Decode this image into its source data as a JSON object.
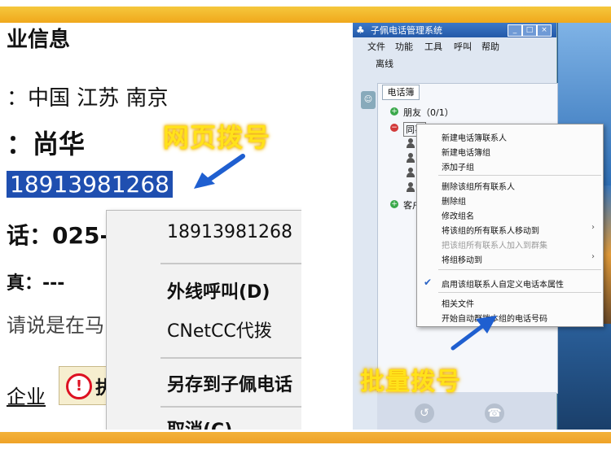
{
  "left_page": {
    "title": "业信息",
    "location": "：中国 江苏 南京",
    "name": "：尚华",
    "phone_selected": "18913981268",
    "tel_row": "话：025-",
    "fax_row": "真：---",
    "note": "请说是在马",
    "company_link": "企业",
    "warn_button_icon": "!",
    "warn_button_label": "执"
  },
  "left_context_menu": {
    "items": [
      {
        "label": "18913981268"
      },
      {
        "label": "外线呼叫(D)"
      },
      {
        "label": "CNetCC代拨"
      },
      {
        "label": "另存到子佩电话"
      },
      {
        "label": "取消(C)"
      }
    ]
  },
  "annotations": {
    "web_dial": "网页拨号",
    "batch_dial": "批量拨号"
  },
  "app_window": {
    "title": "子佩电话管理系统",
    "title_buttons": [
      "_",
      "□",
      "×"
    ],
    "menu": [
      {
        "label": "文件"
      },
      {
        "label": "功能"
      },
      {
        "label": "工具"
      },
      {
        "label": "呼叫"
      },
      {
        "label": "帮助"
      }
    ],
    "status": "离线",
    "tab": "电话簿",
    "tree": [
      {
        "label": "朋友（0/1）",
        "expand": "+"
      },
      {
        "label": "同事",
        "expand": "−"
      },
      {
        "label": "客户",
        "expand": "+"
      }
    ]
  },
  "right_context_menu": {
    "items": [
      {
        "label": "新建电话簿联系人",
        "disabled": false
      },
      {
        "label": "新建电话簿组",
        "disabled": false
      },
      {
        "label": "添加子组",
        "disabled": false
      },
      {
        "label": "删除该组所有联系人",
        "disabled": false
      },
      {
        "label": "删除组",
        "disabled": false
      },
      {
        "label": "修改组名",
        "disabled": false
      },
      {
        "label": "将该组的所有联系人移动到",
        "disabled": false,
        "submenu": true
      },
      {
        "label": "把该组所有联系人加入到群集",
        "disabled": true
      },
      {
        "label": "将组移动到",
        "disabled": false,
        "submenu": true
      },
      {
        "label": "启用该组联系人自定义电话本属性",
        "disabled": false,
        "checked": true
      },
      {
        "label": "相关文件",
        "disabled": false
      },
      {
        "label": "开始自动群拨本组的电话号码",
        "disabled": false
      }
    ],
    "submenu_arrow": "›",
    "check_glyph": "✔"
  },
  "colors": {
    "band": "#f0a81c",
    "annotation_text": "#ffe21a",
    "arrow": "#1f5fd0",
    "selection": "#1f4fb0"
  }
}
